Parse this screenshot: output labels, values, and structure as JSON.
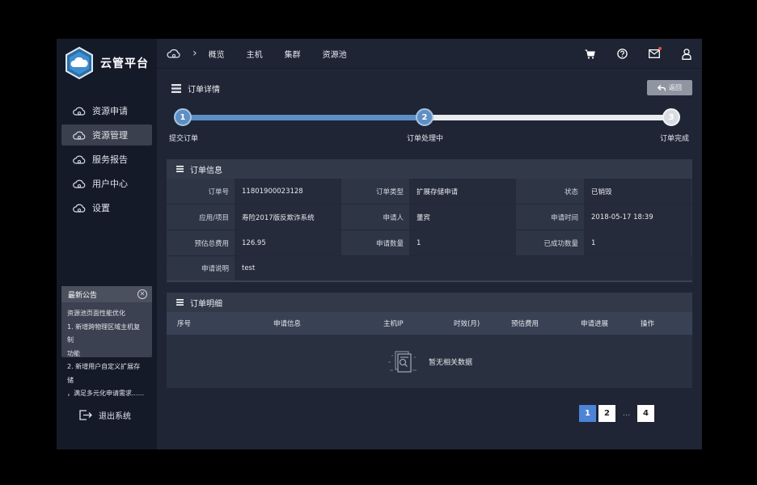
{
  "brand": {
    "title": "云管平台"
  },
  "sidebar": {
    "items": [
      {
        "label": "资源申请",
        "active": false
      },
      {
        "label": "资源管理",
        "active": true
      },
      {
        "label": "服务报告",
        "active": false
      },
      {
        "label": "用户中心",
        "active": false
      },
      {
        "label": "设置",
        "active": false
      }
    ],
    "notice": {
      "title": "最新公告",
      "close": "✕",
      "lines": [
        "资源池页面性能优化",
        "1. 新增跨物理区域主机复制",
        "功能",
        "2. 新增用户自定义扩展存储",
        "，满足多元化申请需求......"
      ]
    },
    "logout_label": "退出系统"
  },
  "topbar": {
    "chevron": "›",
    "tabs": [
      "概览",
      "主机",
      "集群",
      "资源池"
    ]
  },
  "page": {
    "title": "订单详情",
    "back_label": "返回"
  },
  "steps": {
    "progress": 0.5,
    "items": [
      {
        "num": "1",
        "label": "提交订单",
        "state": "done"
      },
      {
        "num": "2",
        "label": "订单处理中",
        "state": "done"
      },
      {
        "num": "3",
        "label": "订单完成",
        "state": "todo"
      }
    ]
  },
  "order_info": {
    "title": "订单信息",
    "rows": [
      [
        {
          "label": "订单号",
          "value": "11801900023128"
        },
        {
          "label": "订单类型",
          "value": "扩展存储申请"
        },
        {
          "label": "状态",
          "value": "已销毁"
        }
      ],
      [
        {
          "label": "应用/项目",
          "value": "寿险2017版反欺诈系统"
        },
        {
          "label": "申请人",
          "value": "董宾"
        },
        {
          "label": "申请时间",
          "value": "2018-05-17 18:39"
        }
      ],
      [
        {
          "label": "预估总费用",
          "value": "126.95"
        },
        {
          "label": "申请数量",
          "value": "1"
        },
        {
          "label": "已成功数量",
          "value": "1"
        }
      ]
    ],
    "remark": {
      "label": "申请说明",
      "value": "test"
    }
  },
  "order_detail": {
    "title": "订单明细",
    "columns": [
      "序号",
      "申请信息",
      "主机IP",
      "时效(月)",
      "预估费用",
      "申请进展",
      "操作"
    ],
    "empty_text": "暂无相关数据"
  },
  "pagination": {
    "prev": "‹",
    "next": "›",
    "pages": [
      "1",
      "2"
    ],
    "ellipsis": "...",
    "last": "4",
    "current": "1"
  },
  "colors": {
    "accent": "#5e8fc4",
    "active_page": "#4c84d6",
    "sidebar_bg": "#151a29",
    "content_bg": "#1f2535"
  }
}
